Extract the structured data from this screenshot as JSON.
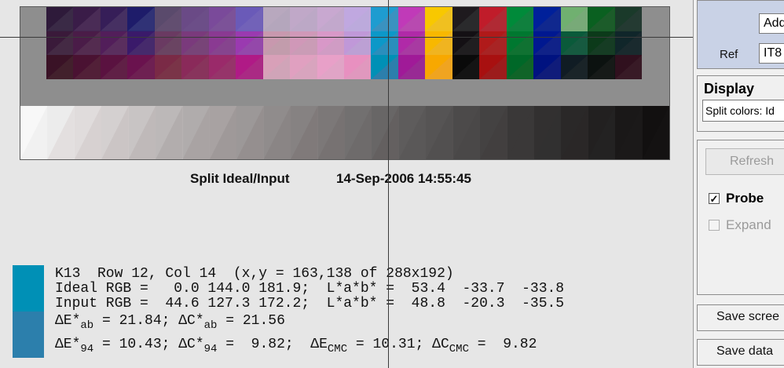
{
  "plot": {
    "title": "Split Ideal/Input",
    "timestamp": "14-Sep-2006 14:55:45"
  },
  "probe": {
    "swatch_ideal_color": "#0090b6",
    "swatch_input_color": "#2c7fac",
    "line1": "K13  Row 12, Col 14  (x,y = 163,138 of 288x192)",
    "line2": "Ideal RGB =   0.0 144.0 181.9;  L*a*b* =  53.4  -33.7  -33.8",
    "line3": "Input RGB =  44.6 127.3 172.2;  L*a*b* =  48.8  -20.3  -35.5",
    "de_ab_label": "ΔE*",
    "ab_sub": "ab",
    "de_ab_value": " = 21.84; ",
    "dc_ab_label": "ΔC*",
    "dc_ab_value": " = 21.56",
    "de_94_label": "ΔE*",
    "sub_94": "94",
    "de_94_value": " = 10.43; ",
    "dc_94_label": "ΔC*",
    "dc_94_value": " =  9.82;  ",
    "de_cmc_label": "ΔE",
    "sub_cmc": "CMC",
    "de_cmc_value": " = 10.31; ",
    "dc_cmc_label": "ΔC",
    "dc_cmc_value": " =  9.82"
  },
  "panel": {
    "file_value": "Add",
    "ref_label": "Ref",
    "ref_value": "IT8",
    "display_title": "Display",
    "display_select": "Split colors: Id",
    "refresh_label": "Refresh",
    "probe_label": "Probe",
    "probe_checked": true,
    "expand_label": "Expand",
    "expand_checked": false,
    "save_screen_label": "Save scree",
    "save_data_label": "Save data"
  },
  "target_colors": {
    "grid_ideal": [
      [
        "#2e1a3a",
        "#3a1c48",
        "#361e58",
        "#1e1c6a",
        "#5a4a6c",
        "#6a4a86",
        "#7a4a9a",
        "#6a5ab8",
        "#b8a8be",
        "#c0a8c8",
        "#c8a8d0",
        "#c0a8e0",
        "#1e9cd0",
        "#c03ab8",
        "#f8c800",
        "#1e1a1e",
        "#c01c2a",
        "#008a3a",
        "#00209a",
        "#70b070",
        "#0a6020",
        "#1a3a2a"
      ],
      [
        "#3a1a3a",
        "#4a1c48",
        "#521e5a",
        "#3a1a6a",
        "#6a3a62",
        "#7a3a7c",
        "#8a3a92",
        "#9a3ab0",
        "#c898ae",
        "#d098b8",
        "#d898c8",
        "#c098d8",
        "#0c98c8",
        "#b02aa8",
        "#f8b800",
        "#141014",
        "#b01a1a",
        "#007830",
        "#001890",
        "#0a5a3a",
        "#0c3a1a",
        "#10262a"
      ],
      [
        "#3a1226",
        "#4a1232",
        "#5a1240",
        "#6a124e",
        "#7a2a46",
        "#8a2a5a",
        "#9a2a6a",
        "#b01a86",
        "#d8a0b8",
        "#e0a0c0",
        "#e8a0c8",
        "#e890c0",
        "#0090b6",
        "#a01a98",
        "#f8a800",
        "#0a0a0a",
        "#a81010",
        "#006828",
        "#001280",
        "#101c24",
        "#0c1210",
        "#30101e"
      ]
    ],
    "grid_input": [
      [
        "#3a2a46",
        "#4a2c56",
        "#463062",
        "#303276",
        "#624e70",
        "#6c4e88",
        "#7c5298",
        "#7262b8",
        "#b4a6bc",
        "#bca8c6",
        "#c2a8cc",
        "#bcaadc",
        "#3a92c0",
        "#b84ab0",
        "#f0c020",
        "#2a2a2c",
        "#b02a34",
        "#10803e",
        "#10288e",
        "#78aa78",
        "#1c5c2a",
        "#243a32"
      ],
      [
        "#442a44",
        "#542c50",
        "#5a2e5e",
        "#462a6c",
        "#6a4462",
        "#784478",
        "#86448e",
        "#9448aa",
        "#c29cac",
        "#ca9cb6",
        "#d09cc4",
        "#bca0d4",
        "#2a8ebc",
        "#a83aa2",
        "#f0b420",
        "#201e20",
        "#a82424",
        "#107232",
        "#102288",
        "#165a40",
        "#163c24",
        "#1a2a2e"
      ],
      [
        "#42202c",
        "#522038",
        "#602046",
        "#6e2052",
        "#7a3448",
        "#88345c",
        "#96346a",
        "#aa2a84",
        "#d0a4b8",
        "#d8a4be",
        "#e0a4c6",
        "#e098be",
        "#2c7fac",
        "#982a94",
        "#f0a420",
        "#141414",
        "#9c1c1c",
        "#106428",
        "#101c7a",
        "#1a2428",
        "#161a18",
        "#381a26"
      ]
    ],
    "ramp_ideal": [
      "#f8f8f8",
      "#ececec",
      "#e0dcdc",
      "#d4d0d0",
      "#c8c4c4",
      "#bcb8b8",
      "#b0acac",
      "#a8a2a2",
      "#9c9898",
      "#908c8c",
      "#868282",
      "#7c7878",
      "#727070",
      "#686666",
      "#5e5c5c",
      "#565454",
      "#4c4a4a",
      "#444242",
      "#3a3838",
      "#323030",
      "#2a2828",
      "#222020",
      "#1a1818",
      "#121010"
    ],
    "ramp_input": [
      "#f0f0f0",
      "#e2dede",
      "#d6d0d0",
      "#cac4c4",
      "#beb8b8",
      "#b2acac",
      "#a8a2a2",
      "#9e9898",
      "#948e8e",
      "#8a8484",
      "#807a7a",
      "#767272",
      "#6e6a6a",
      "#646060",
      "#5a5858",
      "#525050",
      "#4a4848",
      "#424040",
      "#3a3838",
      "#323030",
      "#2a2828",
      "#242222",
      "#1c1a1a",
      "#141212"
    ]
  }
}
